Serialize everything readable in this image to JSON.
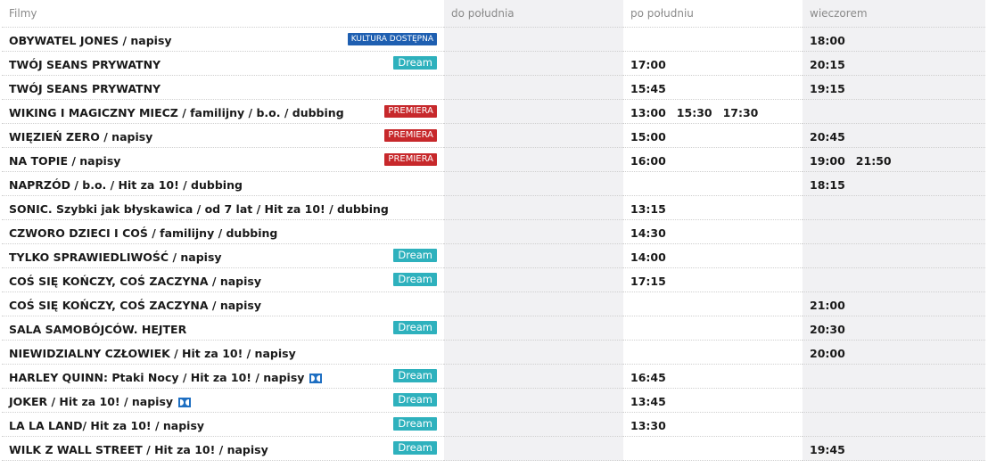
{
  "headers": {
    "films": "Filmy",
    "morning": "do południa",
    "afternoon": "po południu",
    "evening": "wieczorem"
  },
  "badge_colors": {
    "dream": "#2eb1bd",
    "premiera": "#c7282b",
    "kultura": "#1e5fb1"
  },
  "rows": [
    {
      "title": "OBYWATEL JONES / napisy",
      "badge": "KULTURA DOSTĘPNA",
      "badge_type": "kultura",
      "icon": "",
      "morning": [],
      "afternoon": [],
      "evening": [
        "18:00"
      ]
    },
    {
      "title": "TWÓJ SEANS PRYWATNY",
      "badge": "Dream",
      "badge_type": "dream",
      "icon": "",
      "morning": [],
      "afternoon": [
        "17:00"
      ],
      "evening": [
        "20:15"
      ]
    },
    {
      "title": "TWÓJ SEANS PRYWATNY",
      "badge": "",
      "badge_type": "",
      "icon": "",
      "morning": [],
      "afternoon": [
        "15:45"
      ],
      "evening": [
        "19:15"
      ]
    },
    {
      "title": "WIKING I MAGICZNY MIECZ / familijny / b.o. / dubbing",
      "badge": "PREMIERA",
      "badge_type": "premiera",
      "icon": "",
      "morning": [],
      "afternoon": [
        "13:00",
        "15:30",
        "17:30"
      ],
      "evening": []
    },
    {
      "title": "WIĘZIEŃ ZERO / napisy",
      "badge": "PREMIERA",
      "badge_type": "premiera",
      "icon": "",
      "morning": [],
      "afternoon": [
        "15:00"
      ],
      "evening": [
        "20:45"
      ]
    },
    {
      "title": "NA TOPIE / napisy",
      "badge": "PREMIERA",
      "badge_type": "premiera",
      "icon": "",
      "morning": [],
      "afternoon": [
        "16:00"
      ],
      "evening": [
        "19:00",
        "21:50"
      ]
    },
    {
      "title": "NAPRZÓD / b.o. / Hit za 10! / dubbing",
      "badge": "",
      "badge_type": "",
      "icon": "",
      "morning": [],
      "afternoon": [],
      "evening": [
        "18:15"
      ]
    },
    {
      "title": "SONIC. Szybki jak błyskawica / od 7 lat / Hit za 10! / dubbing",
      "badge": "",
      "badge_type": "",
      "icon": "",
      "morning": [],
      "afternoon": [
        "13:15"
      ],
      "evening": []
    },
    {
      "title": "CZWORO DZIECI I COŚ / familijny / dubbing",
      "badge": "",
      "badge_type": "",
      "icon": "",
      "morning": [],
      "afternoon": [
        "14:30"
      ],
      "evening": []
    },
    {
      "title": "TYLKO SPRAWIEDLIWOŚĆ / napisy",
      "badge": "Dream",
      "badge_type": "dream",
      "icon": "",
      "morning": [],
      "afternoon": [
        "14:00"
      ],
      "evening": []
    },
    {
      "title": "COŚ SIĘ KOŃCZY, COŚ ZACZYNA / napisy",
      "badge": "Dream",
      "badge_type": "dream",
      "icon": "",
      "morning": [],
      "afternoon": [
        "17:15"
      ],
      "evening": []
    },
    {
      "title": "COŚ SIĘ KOŃCZY, COŚ ZACZYNA / napisy",
      "badge": "",
      "badge_type": "",
      "icon": "",
      "morning": [],
      "afternoon": [],
      "evening": [
        "21:00"
      ]
    },
    {
      "title": "SALA SAMOBÓJCÓW. HEJTER",
      "badge": "Dream",
      "badge_type": "dream",
      "icon": "",
      "morning": [],
      "afternoon": [],
      "evening": [
        "20:30"
      ]
    },
    {
      "title": "NIEWIDZIALNY CZŁOWIEK / Hit za 10! / napisy",
      "badge": "",
      "badge_type": "",
      "icon": "",
      "morning": [],
      "afternoon": [],
      "evening": [
        "20:00"
      ]
    },
    {
      "title": "HARLEY QUINN: Ptaki Nocy / Hit za 10! / napisy",
      "badge": "Dream",
      "badge_type": "dream",
      "icon": "dolby-icon",
      "morning": [],
      "afternoon": [
        "16:45"
      ],
      "evening": []
    },
    {
      "title": "JOKER / Hit za 10! / napisy",
      "badge": "Dream",
      "badge_type": "dream",
      "icon": "dolby-icon",
      "morning": [],
      "afternoon": [
        "13:45"
      ],
      "evening": []
    },
    {
      "title": "LA LA LAND/ Hit za 10! / napisy",
      "badge": "Dream",
      "badge_type": "dream",
      "icon": "",
      "morning": [],
      "afternoon": [
        "13:30"
      ],
      "evening": []
    },
    {
      "title": "WILK Z WALL STREET / Hit za 10! / napisy",
      "badge": "Dream",
      "badge_type": "dream",
      "icon": "",
      "morning": [],
      "afternoon": [],
      "evening": [
        "19:45"
      ]
    }
  ]
}
